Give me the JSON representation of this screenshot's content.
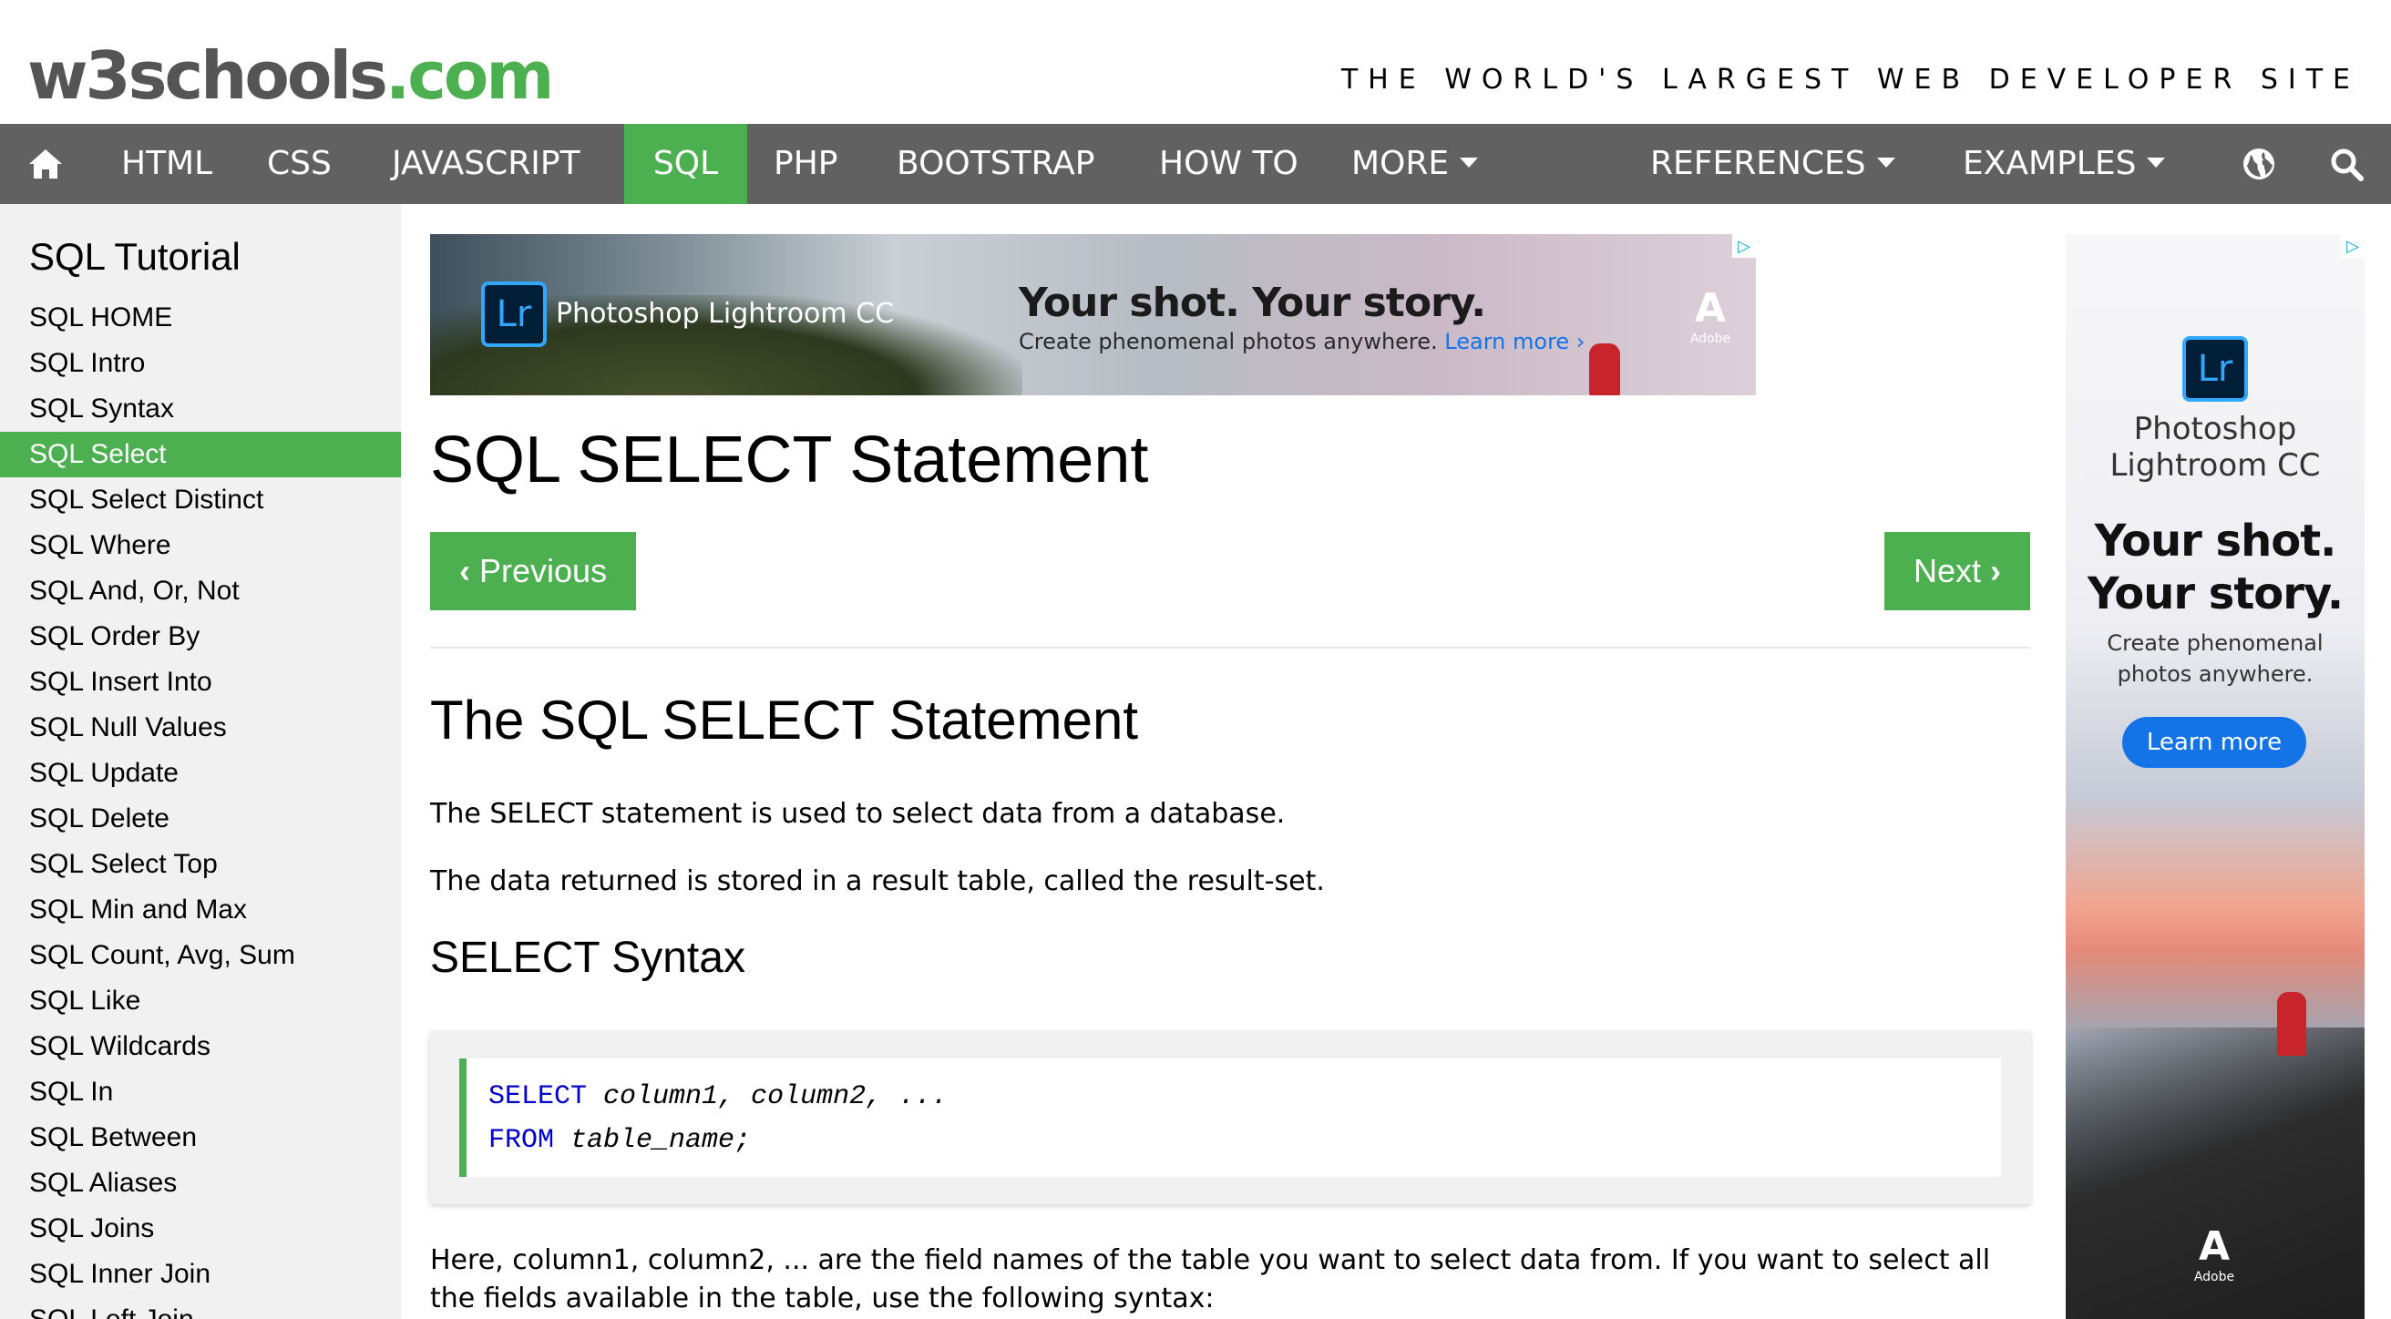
{
  "header": {
    "logo_w3": "w3schools",
    "logo_com": ".com",
    "tagline": "THE WORLD'S LARGEST WEB DEVELOPER SITE"
  },
  "nav": {
    "home_icon": "home-icon",
    "items": [
      {
        "label": "HTML"
      },
      {
        "label": "CSS"
      },
      {
        "label": "JAVASCRIPT"
      },
      {
        "label": "SQL",
        "active": true
      },
      {
        "label": "PHP"
      },
      {
        "label": "BOOTSTRAP"
      },
      {
        "label": "HOW TO"
      },
      {
        "label": "MORE"
      },
      {
        "label": "REFERENCES"
      },
      {
        "label": "EXAMPLES"
      }
    ],
    "globe_icon": "globe-icon",
    "search_icon": "search-icon"
  },
  "sidebar": {
    "title": "SQL Tutorial",
    "items": [
      "SQL HOME",
      "SQL Intro",
      "SQL Syntax",
      "SQL Select",
      "SQL Select Distinct",
      "SQL Where",
      "SQL And, Or, Not",
      "SQL Order By",
      "SQL Insert Into",
      "SQL Null Values",
      "SQL Update",
      "SQL Delete",
      "SQL Select Top",
      "SQL Min and Max",
      "SQL Count, Avg, Sum",
      "SQL Like",
      "SQL Wildcards",
      "SQL In",
      "SQL Between",
      "SQL Aliases",
      "SQL Joins",
      "SQL Inner Join",
      "SQL Left Join"
    ],
    "active_index": 3
  },
  "ad_banner": {
    "logo": "Lr",
    "product": "Photoshop Lightroom CC",
    "headline": "Your shot. Your story.",
    "sub": "Create phenomenal photos anywhere.",
    "link": "Learn more ›",
    "brand": "Adobe"
  },
  "ad_side": {
    "logo": "Lr",
    "product_line1": "Photoshop",
    "product_line2": "Lightroom CC",
    "headline_line1": "Your shot.",
    "headline_line2": "Your story.",
    "sub_line1": "Create phenomenal",
    "sub_line2": "photos anywhere.",
    "button": "Learn more",
    "brand": "Adobe"
  },
  "main": {
    "title": "SQL SELECT Statement",
    "prev_label": "Previous",
    "next_label": "Next",
    "h2": "The SQL SELECT Statement",
    "p1": "The SELECT statement is used to select data from a database.",
    "p2": "The data returned is stored in a result table, called the result-set.",
    "h3": "SELECT Syntax",
    "code": {
      "line1_kw": "SELECT",
      "line1_rest": " column1, column2, ...",
      "line2_kw": "FROM",
      "line2_rest": " table_name;"
    },
    "p3_line1": "Here, column1, column2, ... are the field names of the table you want to select data from. If you want to select all",
    "p3_line2": "the fields available in the table, use the following syntax:"
  },
  "colors": {
    "accent": "#4CAF50",
    "nav_bg": "#616161",
    "sidebar_bg": "#f1f1f1",
    "code_keyword": "#0000cd"
  }
}
